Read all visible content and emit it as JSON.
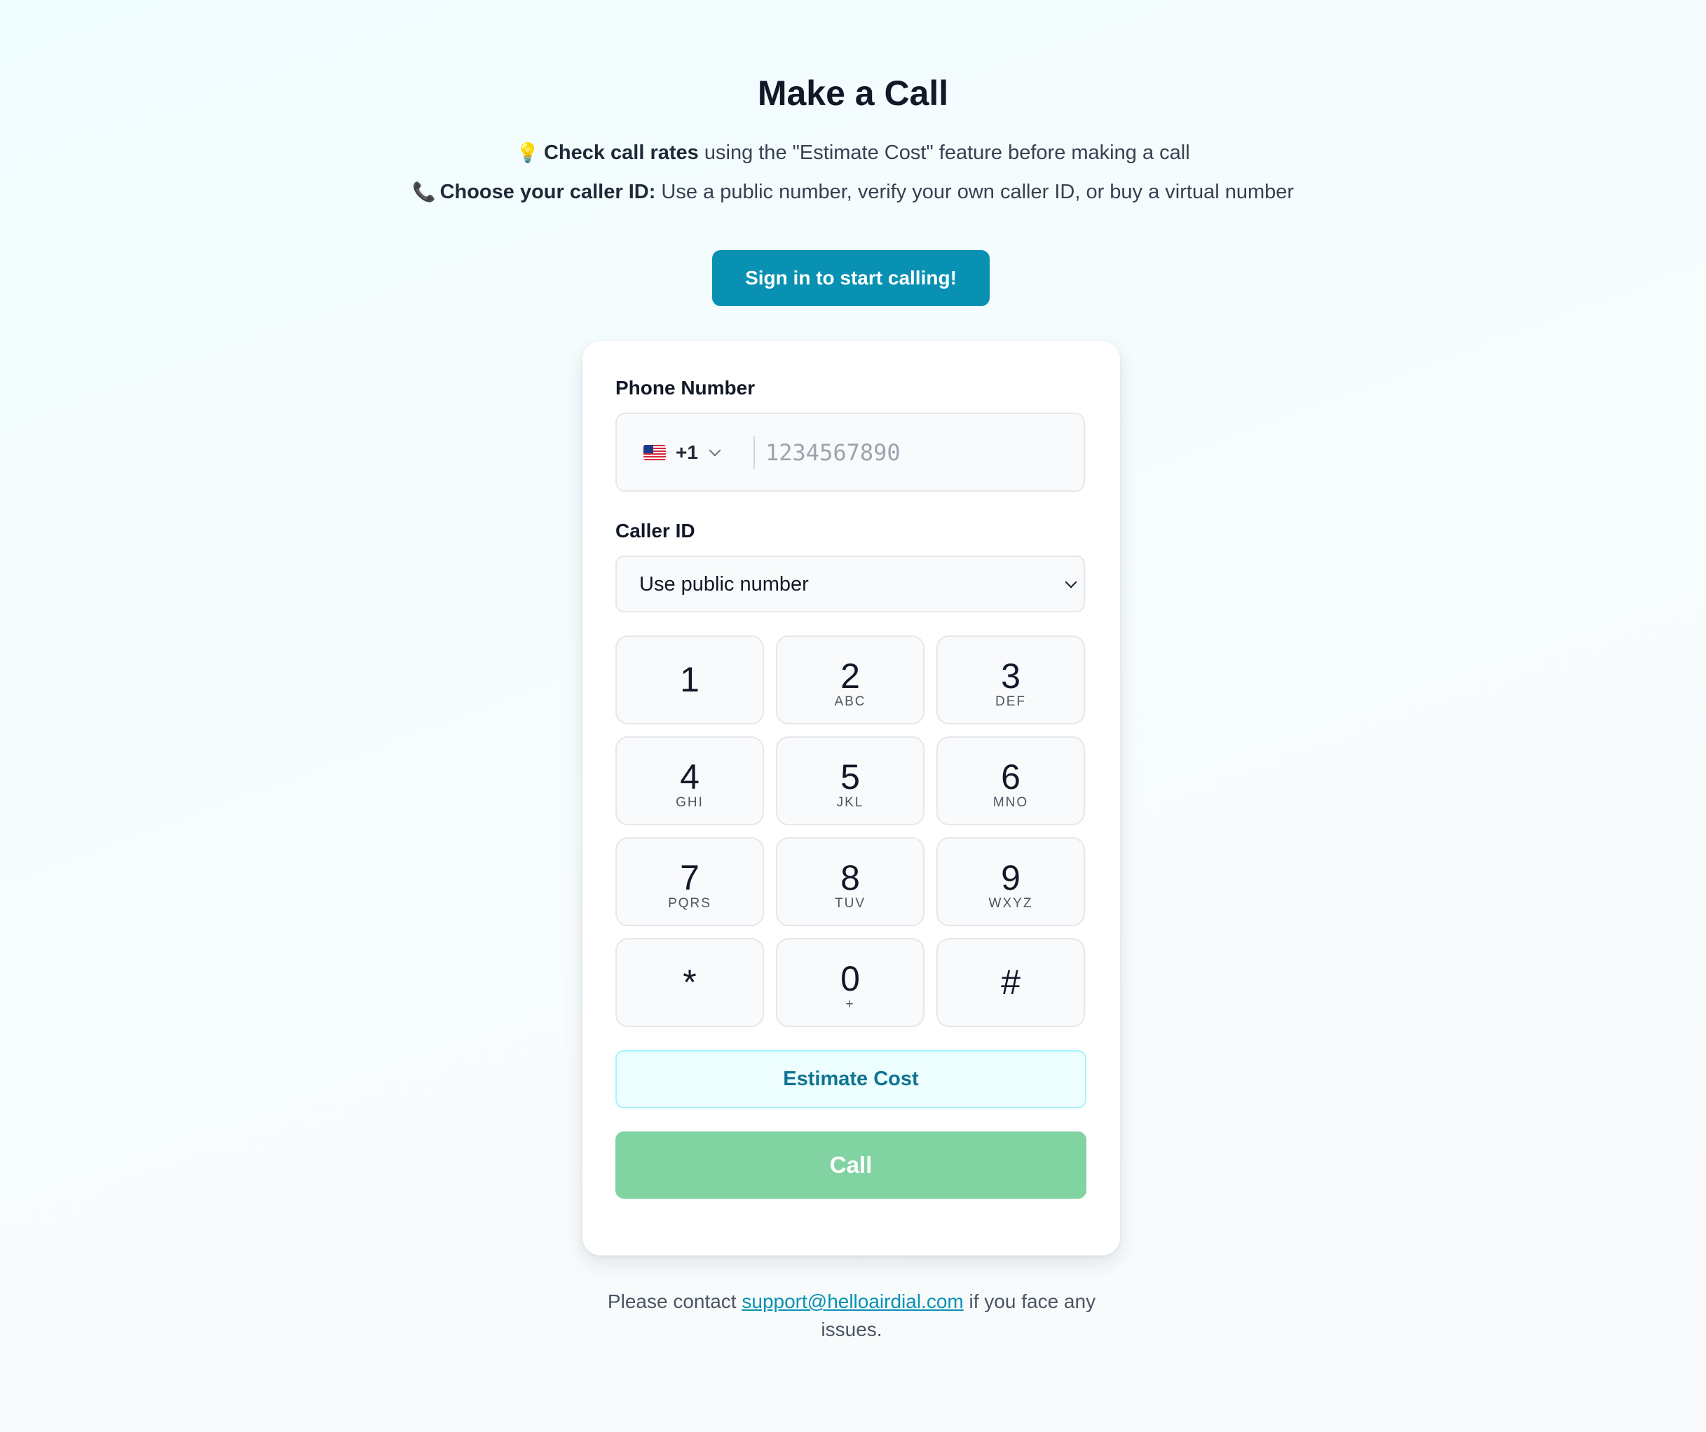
{
  "header": {
    "title": "Make a Call",
    "tips": [
      {
        "icon": "lightbulb-icon",
        "emoji": "💡",
        "bold": "Check call rates",
        "text": " using the \"Estimate Cost\" feature before making a call"
      },
      {
        "icon": "phone-receiver-icon",
        "emoji": "📞",
        "bold": "Choose your caller ID:",
        "text": " Use a public number, verify your own caller ID, or buy a virtual number"
      }
    ],
    "signin_label": "Sign in to start calling!"
  },
  "form": {
    "phone_label": "Phone Number",
    "country_code": "+1",
    "country_flag": "us-flag-icon",
    "phone_value": "",
    "phone_placeholder": "1234567890",
    "caller_label": "Caller ID",
    "caller_value": "Use public number"
  },
  "keypad": {
    "keys": [
      {
        "digit": "1",
        "letters": ""
      },
      {
        "digit": "2",
        "letters": "ABC"
      },
      {
        "digit": "3",
        "letters": "DEF"
      },
      {
        "digit": "4",
        "letters": "GHI"
      },
      {
        "digit": "5",
        "letters": "JKL"
      },
      {
        "digit": "6",
        "letters": "MNO"
      },
      {
        "digit": "7",
        "letters": "PQRS"
      },
      {
        "digit": "8",
        "letters": "TUV"
      },
      {
        "digit": "9",
        "letters": "WXYZ"
      },
      {
        "digit": "*",
        "letters": ""
      },
      {
        "digit": "0",
        "letters": "+"
      },
      {
        "digit": "#",
        "letters": ""
      }
    ]
  },
  "actions": {
    "estimate_label": "Estimate Cost",
    "call_label": "Call"
  },
  "footer": {
    "prefix": "Please contact ",
    "email": "support@helloairdial.com",
    "suffix": " if you face any issues."
  },
  "colors": {
    "accent": "#0891b2",
    "call_button": "#82d3a2",
    "estimate_bg": "#ecfeff",
    "estimate_text": "#0e7490"
  }
}
